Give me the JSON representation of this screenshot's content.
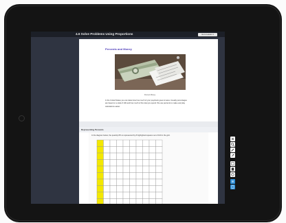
{
  "window": {
    "title": "4.6 Solve Problems Using Proportions",
    "return_button": "Go to Lesson 1"
  },
  "section1": {
    "heading": "Percents and Money",
    "image_alt": "stacks of US currency and receipts",
    "caption": "Percent Money",
    "paragraph": "In the United States you can determine how much of your paycheck goes to taxes. Usually percentages are based on a total of 100 and how much of the total you spend. We use percents to make everyday calculations easier."
  },
  "section2": {
    "title": "Representing Percents",
    "prompt": "In the diagram below, the quantity 8% is represented by 8 highlighted squares out of 100 in the grid.",
    "grid": {
      "columns": 10,
      "rows": 11,
      "highlighted_column": 0,
      "highlight_color": "#f3e800"
    }
  },
  "colors": {
    "tablet_body": "#141414",
    "screen_bg": "#2f3441",
    "heading_accent": "#4b39b8",
    "tool_active": "#2f8fd8"
  },
  "side_tools": [
    "close-icon",
    "zoom-in-icon",
    "pen-icon",
    "expand-icon",
    "note-icon",
    "calculator-icon",
    "glossary-icon",
    "settings-icon",
    "notebook-icon"
  ]
}
